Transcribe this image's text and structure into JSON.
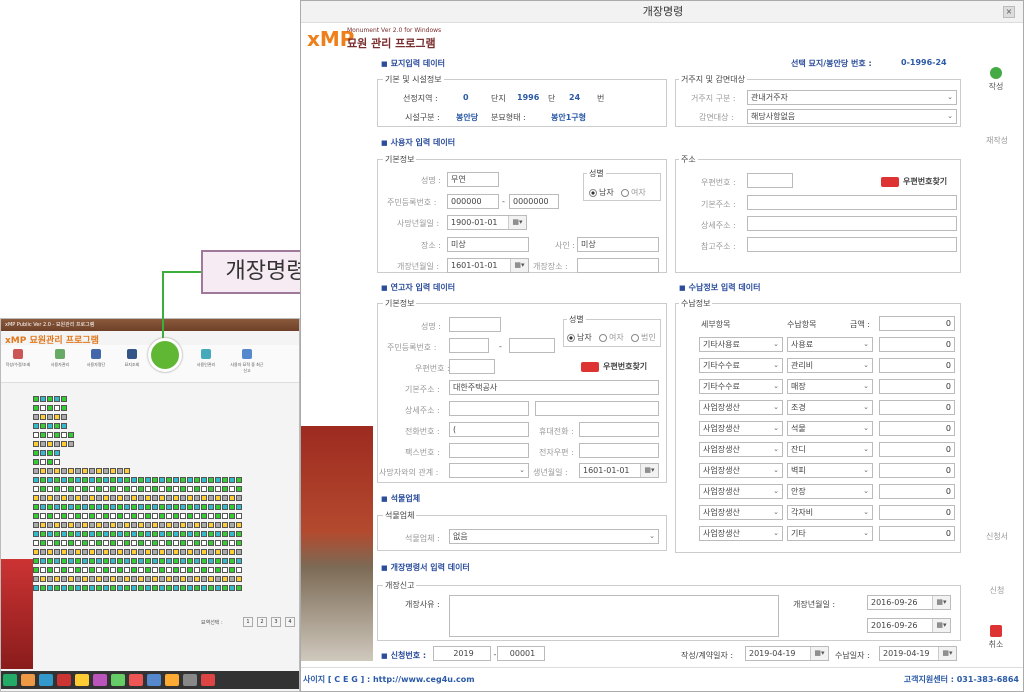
{
  "background_app": {
    "title": "xMP Public Ver 2.0 - 묘원관리 프로그램",
    "logo": "xMP 묘원관리 프로그램",
    "toolbar": [
      "작성/수정/조회",
      "사용자관리",
      "사용자명단",
      "묘지조회",
      "",
      "사용인관리",
      "사용자 묘적 중 최근 신고"
    ],
    "pager": [
      "1",
      "2",
      "3",
      "4"
    ],
    "pager_label": "묘역선택 :"
  },
  "callout": {
    "label": "개장명령"
  },
  "dialog": {
    "title": "개장명령",
    "logo": {
      "x": "xMP",
      "sub": "Monument Ver 2.0 for Windows",
      "kr": "묘원 관리 프로그램"
    },
    "selected_label": "선택 묘지/봉안당 번호 :",
    "selected_value": "0-1996-24",
    "side": {
      "create": "작성",
      "rewrite": "재작성",
      "apply_form": "신청서",
      "apply": "신청",
      "cancel": "취소"
    },
    "grave_section": {
      "title": "묘지입력 데이터",
      "basic_title": "기본 및 시설정보",
      "region_label": "선정지역 :",
      "region": "0",
      "complex_label": "단지",
      "complex": "1996",
      "step_label": "단",
      "step": "24",
      "no_label": "번",
      "facility_label": "시설구분 :",
      "facility": "봉안당",
      "burial_label": "분묘형태 :",
      "burial": "봉안1구형",
      "residence_title": "거주지 및 감면대상",
      "residence_label": "거주지 구분 :",
      "residence": "관내거주자",
      "reduction_label": "감면대상 :",
      "reduction": "해당사항없음"
    },
    "user_section": {
      "title": "사용자 입력 데이터",
      "basic_title": "기본정보",
      "name_label": "성명 :",
      "name": "무연",
      "gender_title": "성별",
      "male": "남자",
      "female": "여자",
      "rrn_label": "주민등록번호 :",
      "rrn1": "000000",
      "rrn_dash": "-",
      "rrn2": "0000000",
      "death_date_label": "사망년월일 :",
      "death_date": "1900-01-01",
      "funeral_label": "장소 :",
      "funeral": "미상",
      "cause_label": "사인 :",
      "cause": "미상",
      "burial_date_label": "개장년월일 :",
      "burial_date": "1601-01-01",
      "burial_place_label": "개장장소 :",
      "address_title": "주소",
      "zip_label": "우편번호 :",
      "zip_search": "우편번호찾기",
      "addr1_label": "기본주소 :",
      "addr2_label": "상세주소 :",
      "addr3_label": "참고주소 :"
    },
    "relative_section": {
      "title": "연고자 입력 데이터",
      "basic_title": "기본정보",
      "name_label": "성명 :",
      "gender_title": "성별",
      "male": "남자",
      "female": "여자",
      "corp": "법인",
      "rrn_label": "주민등록번호 :",
      "rrn_dash": "-",
      "zip_label": "우편번호 :",
      "zip_search": "우편번호찾기",
      "addr1_label": "기본주소 :",
      "addr1": "대한주택공사",
      "addr2_label": "상세주소 :",
      "phone_label": "전화번호 :",
      "phone": "(",
      "mobile_label": "휴대전화 :",
      "fax_label": "팩스번호 :",
      "email_label": "전자우편 :",
      "relation_label": "사망자와의 관계 :",
      "birth_label": "생년월일 :",
      "birth": "1601-01-01"
    },
    "payment_section": {
      "title": "수납정보 입력 데이터",
      "sub_title": "수납정보",
      "col_detail": "세부항목",
      "col_item": "수납항목",
      "col_amount": "금액 :",
      "rows": [
        {
          "detail": "",
          "item": "",
          "amount": "0"
        },
        {
          "detail": "기타사용료",
          "item": "사용료",
          "amount": "0"
        },
        {
          "detail": "기타수수료",
          "item": "관리비",
          "amount": "0"
        },
        {
          "detail": "기타수수료",
          "item": "매장",
          "amount": "0"
        },
        {
          "detail": "사업장생산",
          "item": "조경",
          "amount": "0"
        },
        {
          "detail": "사업장생산",
          "item": "석물",
          "amount": "0"
        },
        {
          "detail": "사업장생산",
          "item": "잔디",
          "amount": "0"
        },
        {
          "detail": "사업장생산",
          "item": "벽피",
          "amount": "0"
        },
        {
          "detail": "사업장생산",
          "item": "안장",
          "amount": "0"
        },
        {
          "detail": "사업장생산",
          "item": "각자비",
          "amount": "0"
        },
        {
          "detail": "사업장생산",
          "item": "기타",
          "amount": "0"
        }
      ]
    },
    "stone_section": {
      "title": "석물업체",
      "sub_title": "석물업체",
      "label": "석물업체 :",
      "value": "없음"
    },
    "order_section": {
      "title": "개장명령서 입력 데이터",
      "sub_title": "개장신고",
      "reason_label": "개장사유 :",
      "date_label": "개장년월일 :",
      "date1": "2016-09-26",
      "date2": "2016-09-26"
    },
    "bottom": {
      "apply_no_label": "신청번호 :",
      "apply_year": "2019",
      "apply_dash": "-",
      "apply_no": "00001",
      "write_date_label": "작성/계약일자 :",
      "write_date": "2019-04-19",
      "pay_date_label": "수납일자 :",
      "pay_date": "2019-04-19"
    },
    "footer": {
      "left": "사이지 [ C E G ] : http://www.ceg4u.com",
      "right": "고객지원센터 : 031-383-6864"
    }
  },
  "colors": {
    "accent": "#2b4d9c",
    "callout_green": "#5fb734",
    "logo_orange": "#ef7f1a"
  }
}
